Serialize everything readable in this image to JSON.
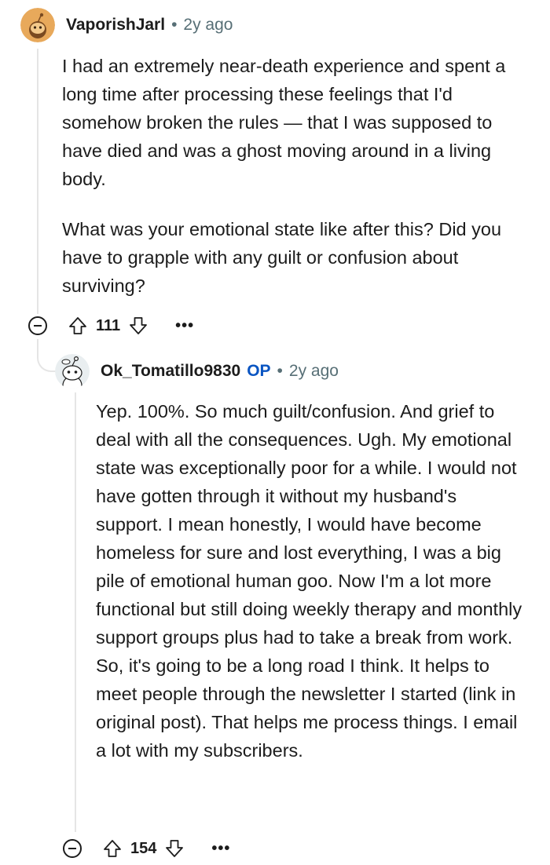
{
  "comment1": {
    "author": "VaporishJarl",
    "separator": "•",
    "time": "2y ago",
    "paragraphs": [
      "I had an extremely near-death experience and spent a long time after processing these feelings that I'd somehow broken the rules — that I was supposed to have died and was a ghost moving around in a living body.",
      "What was your emotional state like after this? Did you have to grapple with any guilt or confusion about surviving?"
    ],
    "score": "111",
    "more": "•••"
  },
  "comment2": {
    "author": "Ok_Tomatillo9830",
    "op_badge": "OP",
    "separator": "•",
    "time": "2y ago",
    "paragraphs": [
      "Yep. 100%. So much guilt/confusion. And grief to deal with all the consequences. Ugh. My emotional state was exceptionally poor for a while. I would not have gotten through it without my husband's support. I mean honestly, I would have become homeless for sure and lost everything, I was a big pile of emotional human goo. Now I'm a lot more functional but still doing weekly therapy and monthly support groups plus had to take a break from work. So, it's going to be a long road I think. It helps to meet people through the newsletter I started (link in original post). That helps me process things. I email a lot with my subscribers."
    ],
    "score": "154",
    "more": "•••"
  },
  "colors": {
    "op_badge": "#0a55c2",
    "meta_gray": "#576f76",
    "avatar1_bg": "#e8a95b",
    "avatar2_bg": "#e9eef0"
  },
  "icons": [
    "snoo-avatar-icon",
    "collapse-icon",
    "upvote-icon",
    "downvote-icon",
    "more-options-icon"
  ]
}
